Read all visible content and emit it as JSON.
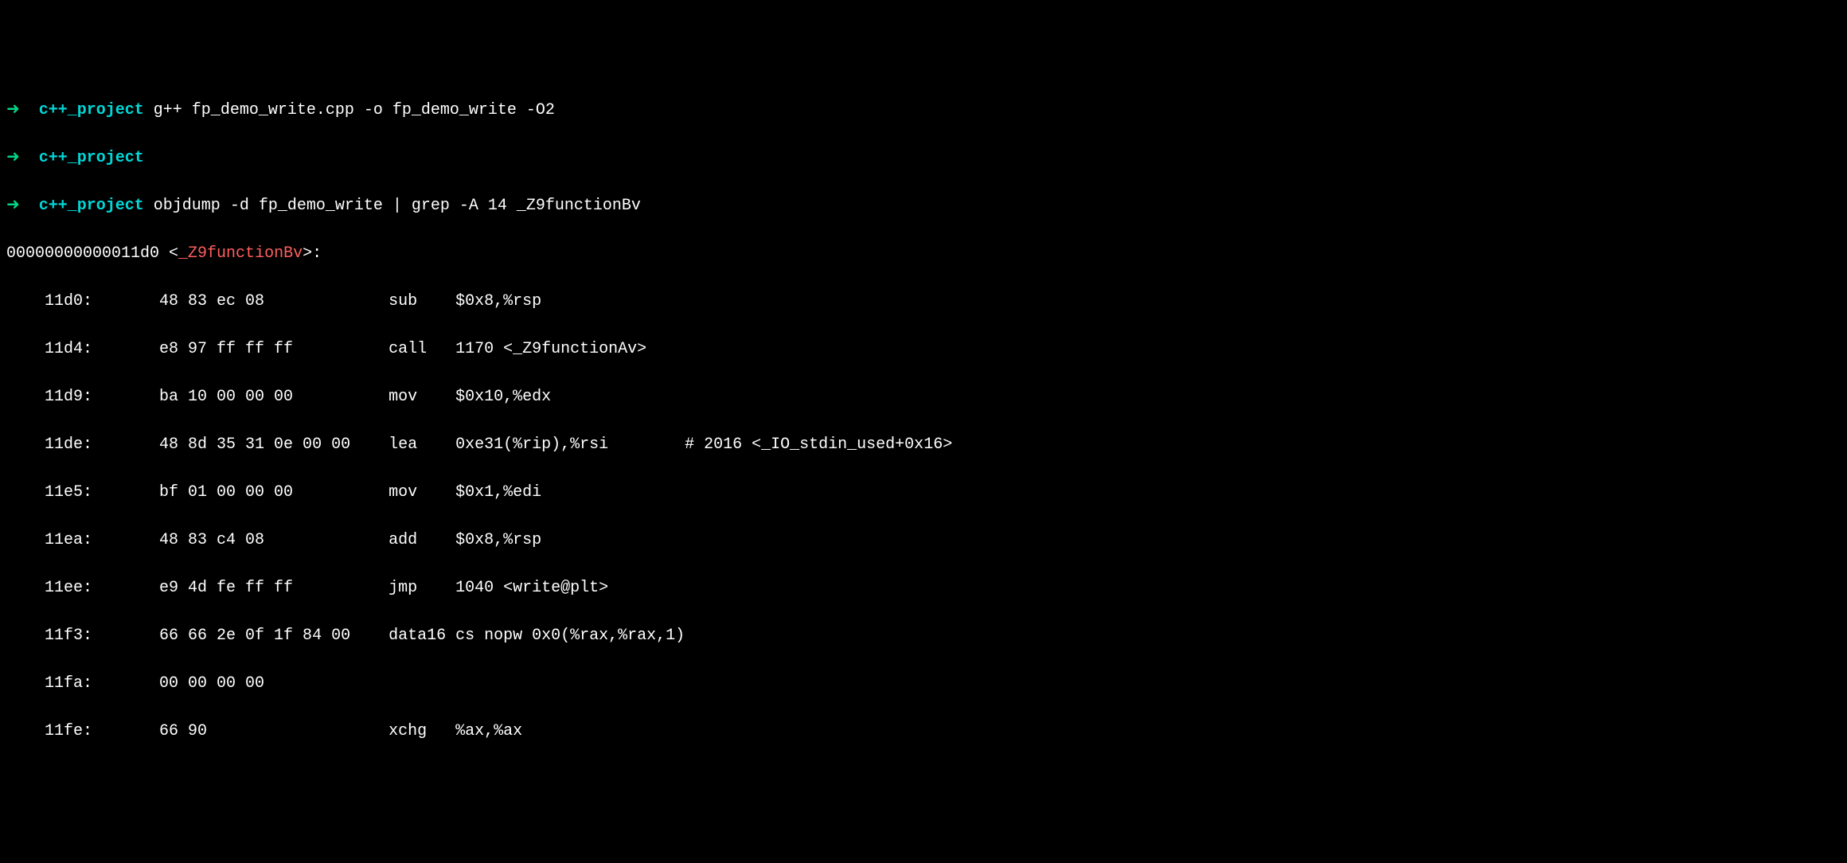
{
  "prompts": [
    {
      "arrow": "➜  ",
      "dir": "c++_project",
      "cmd": " g++ fp_demo_write.cpp -o fp_demo_write -O2"
    },
    {
      "arrow": "➜  ",
      "dir": "c++_project",
      "cmd": ""
    },
    {
      "arrow": "➜  ",
      "dir": "c++_project",
      "cmd": " objdump -d fp_demo_write | grep -A 14 _Z9functionBv"
    }
  ],
  "header": {
    "addr": "00000000000011d0 <",
    "symbol": "_Z9functionBv",
    "suffix": ">:"
  },
  "asm_lines": [
    "    11d0:       48 83 ec 08             sub    $0x8,%rsp",
    "    11d4:       e8 97 ff ff ff          call   1170 <_Z9functionAv>",
    "    11d9:       ba 10 00 00 00          mov    $0x10,%edx",
    "    11de:       48 8d 35 31 0e 00 00    lea    0xe31(%rip),%rsi        # 2016 <_IO_stdin_used+0x16>",
    "    11e5:       bf 01 00 00 00          mov    $0x1,%edi",
    "    11ea:       48 83 c4 08             add    $0x8,%rsp",
    "    11ee:       e9 4d fe ff ff          jmp    1040 <write@plt>",
    "    11f3:       66 66 2e 0f 1f 84 00    data16 cs nopw 0x0(%rax,%rax,1)",
    "    11fa:       00 00 00 00 ",
    "    11fe:       66 90                   xchg   %ax,%ax"
  ]
}
